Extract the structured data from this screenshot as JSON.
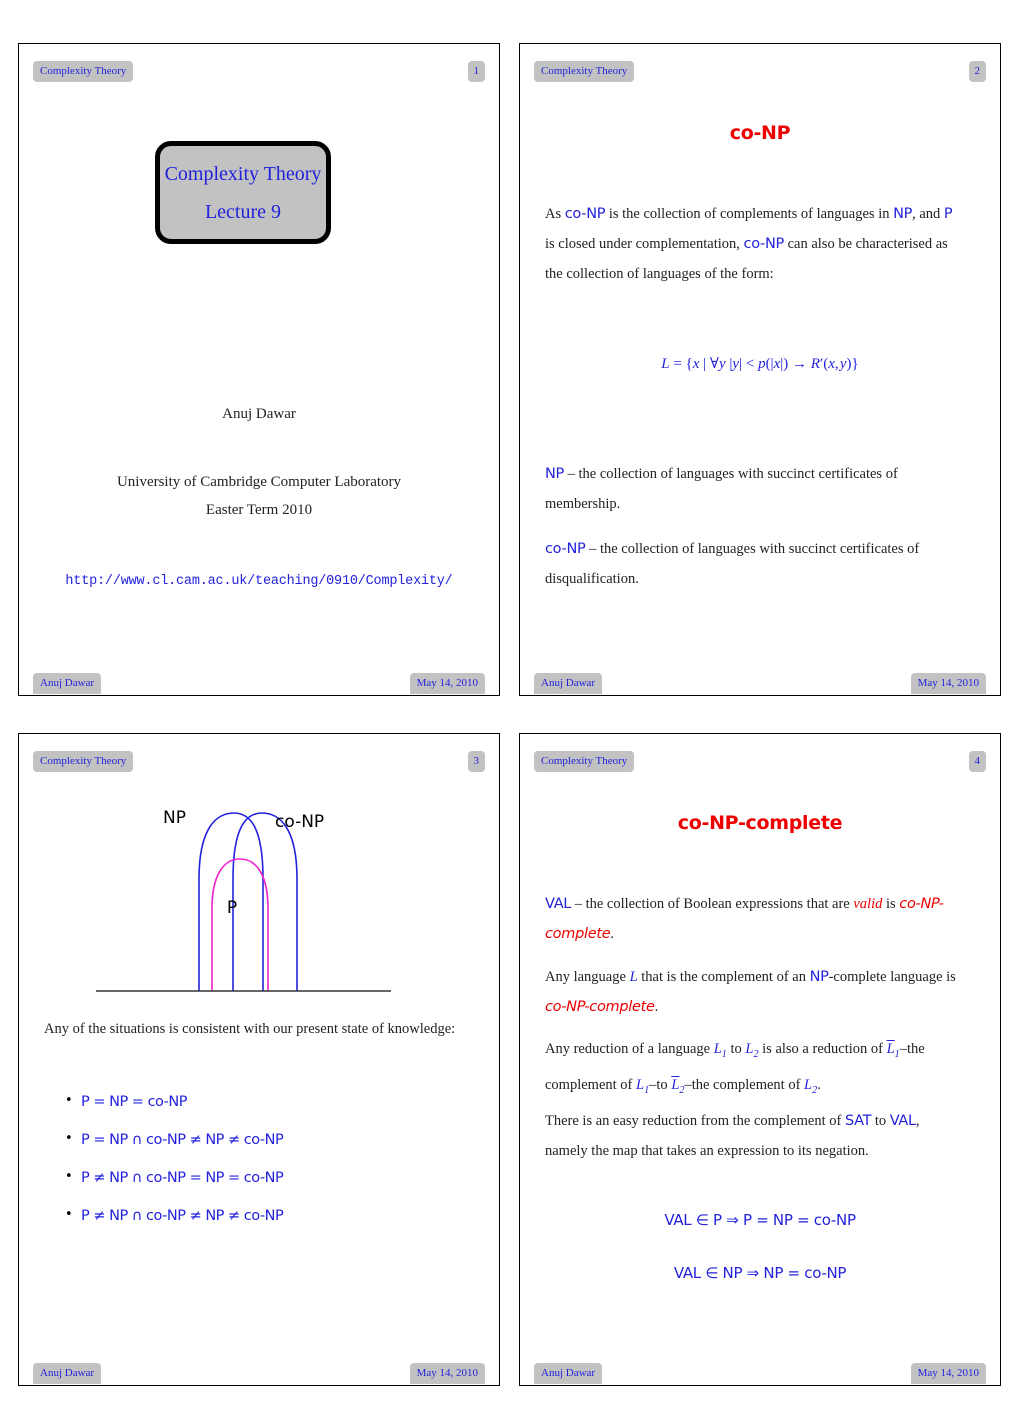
{
  "document": {
    "course": "Complexity Theory",
    "author": "Anuj Dawar",
    "date": "May 14, 2010"
  },
  "slides": [
    {
      "number": "1",
      "header": "Complexity Theory",
      "footer_author": "Anuj Dawar",
      "footer_date": "May 14, 2010",
      "title_box": {
        "line1": "Complexity Theory",
        "line2": "Lecture 9"
      },
      "author": "Anuj Dawar",
      "affiliation_line1": "University of Cambridge Computer Laboratory",
      "affiliation_line2": "Easter Term 2010",
      "url": "http://www.cl.cam.ac.uk/teaching/0910/Complexity/"
    },
    {
      "number": "2",
      "header": "Complexity Theory",
      "footer_author": "Anuj Dawar",
      "footer_date": "May 14, 2010",
      "title": "co-NP",
      "paragraph1": "As co-NP is the collection of complements of languages in NP, and P is closed under complementation, co-NP can also be characterised as the collection of languages of the form:",
      "formula": "L = {x | ∀y |y| < p(|x|) → R'(x, y)}",
      "paragraph2": "NP – the collection of languages with succinct certificates of membership.",
      "paragraph3": "co-NP – the collection of languages with succinct certificates of disqualification."
    },
    {
      "number": "3",
      "header": "Complexity Theory",
      "footer_author": "Anuj Dawar",
      "footer_date": "May 14, 2010",
      "diagram": {
        "label_np": "NP",
        "label_conp": "co-NP",
        "label_p": "P",
        "color_np": "#2222dd",
        "color_conp": "#2222dd",
        "color_p": "#ee22cc",
        "color_baseline": "#333333"
      },
      "paragraph1": "Any of the situations is consistent with our present state of knowledge:",
      "bullets": [
        "P = NP = co-NP",
        "P = NP ∩ co-NP ≠ NP ≠ co-NP",
        "P ≠ NP ∩ co-NP = NP = co-NP",
        "P ≠ NP ∩ co-NP ≠ NP ≠ co-NP"
      ]
    },
    {
      "number": "4",
      "header": "Complexity Theory",
      "footer_author": "Anuj Dawar",
      "footer_date": "May 14, 2010",
      "title": "co-NP-complete",
      "paragraph1": "VAL – the collection of Boolean expressions that are valid is co-NP-complete.",
      "paragraph2": "Any language L that is the complement of an NP-complete language is co-NP-complete.",
      "paragraph3": "Any reduction of a language L1 to L2 is also a reduction of L̄1–the complement of L1–to L̄2–the complement of L2.",
      "paragraph4": "There is an easy reduction from the complement of SAT to VAL, namely the map that takes an expression to its negation.",
      "formula1": "VAL ∈ P ⇒ P = NP = co-NP",
      "formula2": "VAL ∈ NP ⇒ NP = co-NP"
    }
  ]
}
